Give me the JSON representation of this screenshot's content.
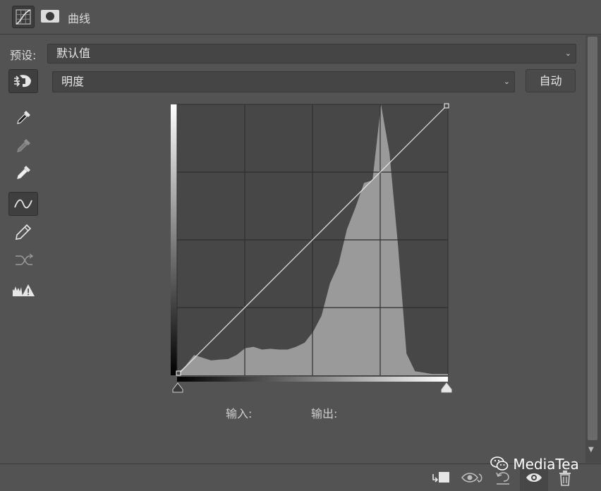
{
  "header": {
    "title": "曲线",
    "icons": [
      "curves-adjustment-icon",
      "mask-icon"
    ]
  },
  "preset": {
    "label": "预设:",
    "value": "默认值"
  },
  "channel": {
    "value": "明度",
    "auto_label": "自动"
  },
  "tools": [
    "on-image-adjust-icon",
    "black-point-eyedropper-icon",
    "gray-point-eyedropper-icon",
    "white-point-eyedropper-icon",
    "curve-point-edit-icon",
    "pencil-draw-icon",
    "smooth-curve-icon",
    "clipping-warning-icon"
  ],
  "readout": {
    "input_label": "输入:",
    "output_label": "输出:"
  },
  "footer": {
    "icons": [
      "clip-to-layer-icon",
      "view-previous-state-icon",
      "reset-icon",
      "visibility-eye-icon",
      "delete-icon"
    ]
  },
  "watermark": {
    "text": "MediaTea"
  },
  "colors": {
    "panel_bg": "#535353",
    "graph_bg": "#474747",
    "histogram": "#9a9a9a",
    "curve": "#e8e8e8"
  },
  "chart_data": {
    "type": "area",
    "x": [
      0,
      8,
      16,
      24,
      32,
      40,
      48,
      56,
      64,
      72,
      80,
      88,
      96,
      104,
      112,
      120,
      128,
      136,
      144,
      152,
      160,
      168,
      176,
      184,
      192,
      200,
      208,
      216,
      224,
      232,
      240,
      248,
      256
    ],
    "values": [
      0.5,
      3.5,
      7.5,
      6.5,
      5.5,
      5.8,
      6.0,
      7.5,
      10.0,
      10.5,
      9.5,
      9.8,
      9.5,
      9.5,
      10.5,
      12.0,
      16.0,
      22.0,
      34.0,
      41.0,
      54.0,
      62.0,
      71.0,
      72.0,
      100.0,
      82.0,
      48.0,
      8.0,
      1.5,
      1.0,
      0.5,
      0.5,
      0.5
    ],
    "curve": [
      [
        0,
        0
      ],
      [
        255,
        255
      ]
    ],
    "xlim": [
      0,
      255
    ],
    "ylim": [
      0,
      100
    ],
    "grid": true
  }
}
